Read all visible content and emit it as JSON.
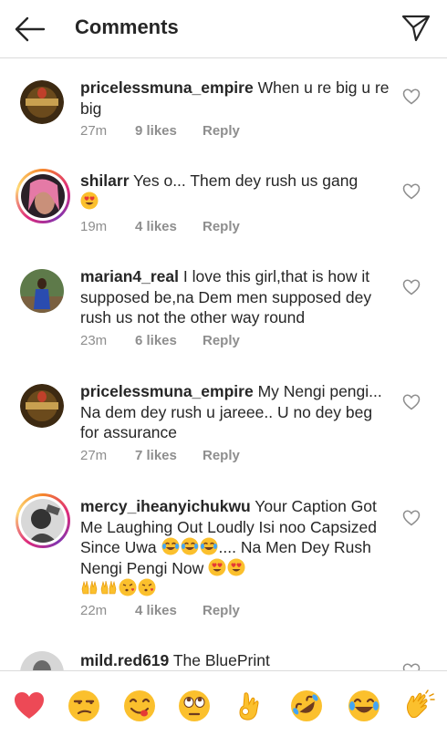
{
  "header": {
    "title": "Comments"
  },
  "comments": [
    {
      "username": "pricelessmuna_empire",
      "text": "When u re big u re big",
      "time": "27m",
      "likes": "9 likes",
      "reply": "Reply"
    },
    {
      "username": "shilarr",
      "text": "Yes o... Them dey rush us gang",
      "time": "19m",
      "likes": "4 likes",
      "reply": "Reply"
    },
    {
      "username": "marian4_real",
      "text": "I love this girl,that is how it supposed be,na Dem men supposed dey rush us not the other way round",
      "time": "23m",
      "likes": "6 likes",
      "reply": "Reply"
    },
    {
      "username": "pricelessmuna_empire",
      "text": "My Nengi pengi... Na dem dey rush u jareee.. U no dey beg for assurance",
      "time": "27m",
      "likes": "7 likes",
      "reply": "Reply"
    },
    {
      "username": "mercy_iheanyichukwu",
      "text": "Your Caption Got Me Laughing Out Loudly Isi noo Capsized Since Uwa",
      "text2": ".... Na Men Dey Rush Nengi Pengi Now",
      "time": "22m",
      "likes": "4 likes",
      "reply": "Reply"
    },
    {
      "username": "mild.red619",
      "text": "The BluePrint"
    }
  ],
  "emoji_bar": [
    "heart",
    "unamused-face",
    "face-savoring-food",
    "face-with-rolling-eyes",
    "ok-hand",
    "rolling-on-floor-laughing",
    "face-with-tears-of-joy",
    "clapping-hands"
  ],
  "colors": {
    "text": "#262626",
    "meta": "#8e8e8e",
    "divider": "#dbdbdb",
    "heart_red": "#ed4956",
    "emoji_yellow": "#fbc02d"
  }
}
